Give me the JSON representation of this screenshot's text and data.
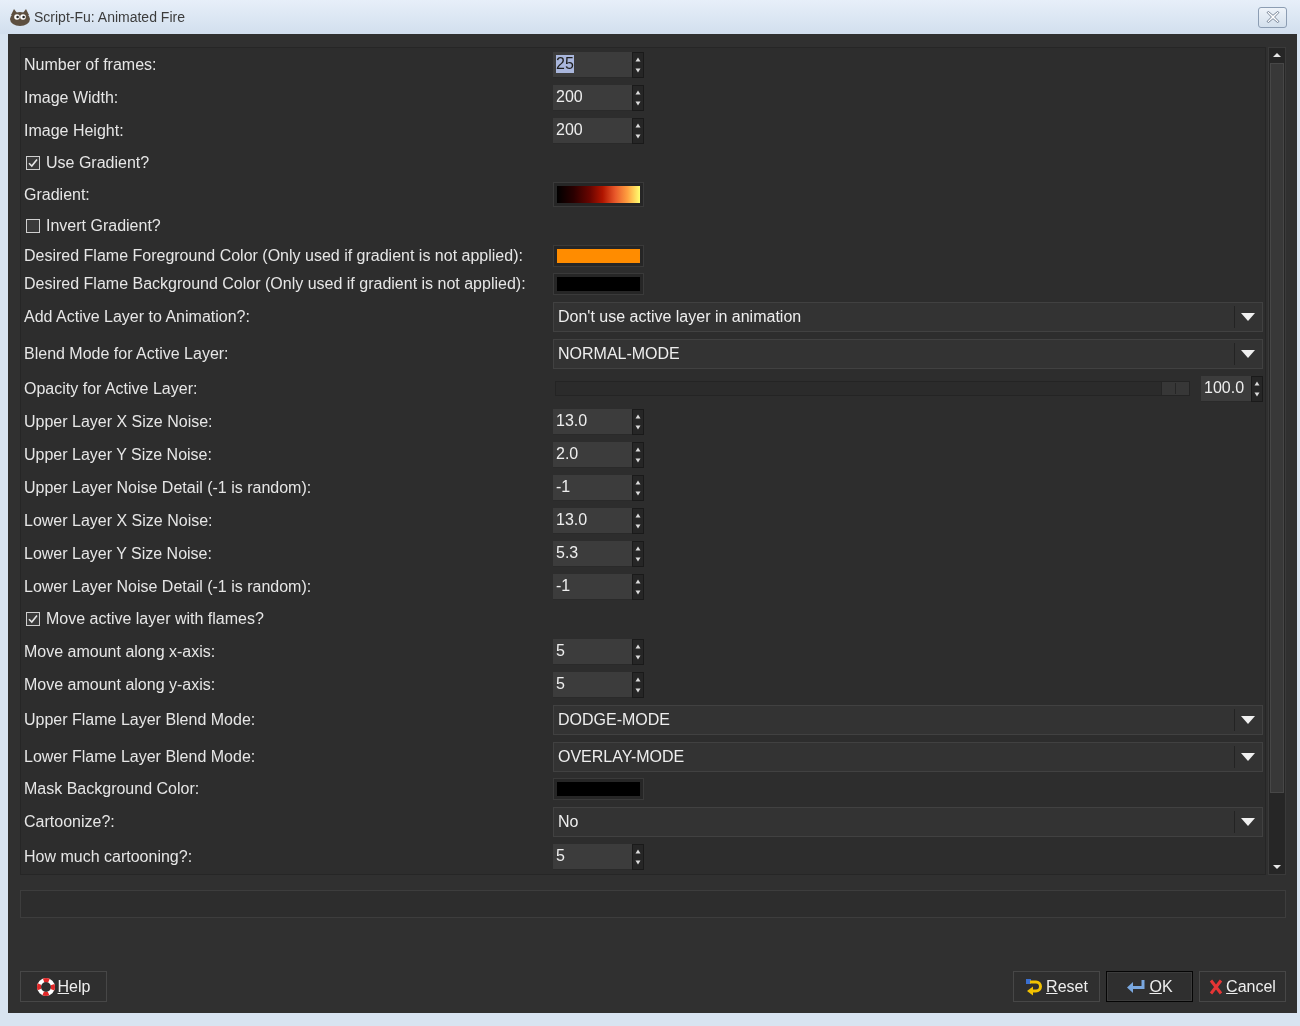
{
  "window": {
    "title": "Script-Fu: Animated Fire"
  },
  "rows": [
    {
      "kind": "spin",
      "label": "Number of frames:",
      "value": "25",
      "value_selected": true
    },
    {
      "kind": "spin",
      "label": "Image Width:",
      "value": "200",
      "value_selected": false
    },
    {
      "kind": "spin",
      "label": "Image Height:",
      "value": "200",
      "value_selected": false
    },
    {
      "kind": "check",
      "label": "Use Gradient?",
      "checked": true
    },
    {
      "kind": "gradient",
      "label": "Gradient:"
    },
    {
      "kind": "check",
      "label": "Invert Gradient?",
      "checked": false
    },
    {
      "kind": "color",
      "label": "Desired Flame Foreground Color (Only used if gradient is not applied):",
      "color": "#ff8c00"
    },
    {
      "kind": "color",
      "label": "Desired Flame Background Color (Only used if gradient is not applied):",
      "color": "#000000"
    },
    {
      "kind": "combo",
      "label": "Add Active Layer to Animation?:",
      "value": "Don't use active layer in animation"
    },
    {
      "kind": "combo",
      "label": "Blend Mode for Active Layer:",
      "value": "NORMAL-MODE"
    },
    {
      "kind": "slider",
      "label": "Opacity for Active Layer:",
      "level": 1,
      "value": "100.0"
    },
    {
      "kind": "spin",
      "label": "Upper Layer X Size Noise:",
      "value": "13.0",
      "value_selected": false
    },
    {
      "kind": "spin",
      "label": "Upper Layer Y Size Noise:",
      "value": "2.0",
      "value_selected": false
    },
    {
      "kind": "spin",
      "label": "Upper Layer Noise Detail (-1 is random):",
      "value": "-1",
      "value_selected": false
    },
    {
      "kind": "spin",
      "label": "Lower Layer X Size Noise:",
      "value": "13.0",
      "value_selected": false
    },
    {
      "kind": "spin",
      "label": "Lower Layer Y Size Noise:",
      "value": "5.3",
      "value_selected": false
    },
    {
      "kind": "spin",
      "label": "Lower Layer Noise Detail (-1 is random):",
      "value": "-1",
      "value_selected": false
    },
    {
      "kind": "check",
      "label": "Move active layer with flames?",
      "checked": true
    },
    {
      "kind": "spin",
      "label": "Move amount along x-axis:",
      "value": "5",
      "value_selected": false
    },
    {
      "kind": "spin",
      "label": "Move amount along y-axis:",
      "value": "5",
      "value_selected": false
    },
    {
      "kind": "combo",
      "label": "Upper Flame Layer Blend Mode:",
      "value": "DODGE-MODE"
    },
    {
      "kind": "combo",
      "label": "Lower Flame Layer Blend Mode:",
      "value": "OVERLAY-MODE"
    },
    {
      "kind": "color",
      "label": "Mask Background Color:",
      "color": "#000000"
    },
    {
      "kind": "combo",
      "label": "Cartoonize?:",
      "value": "No"
    },
    {
      "kind": "spin",
      "label": "How much cartooning?:",
      "value": "5",
      "value_selected": false
    }
  ],
  "buttons": [
    {
      "kind": "help",
      "label": "Help",
      "default": false
    },
    {
      "kind": "reset",
      "label": "Reset",
      "default": false
    },
    {
      "kind": "ok",
      "label": "OK",
      "default": true
    },
    {
      "kind": "cancel",
      "label": "Cancel",
      "default": false
    }
  ]
}
